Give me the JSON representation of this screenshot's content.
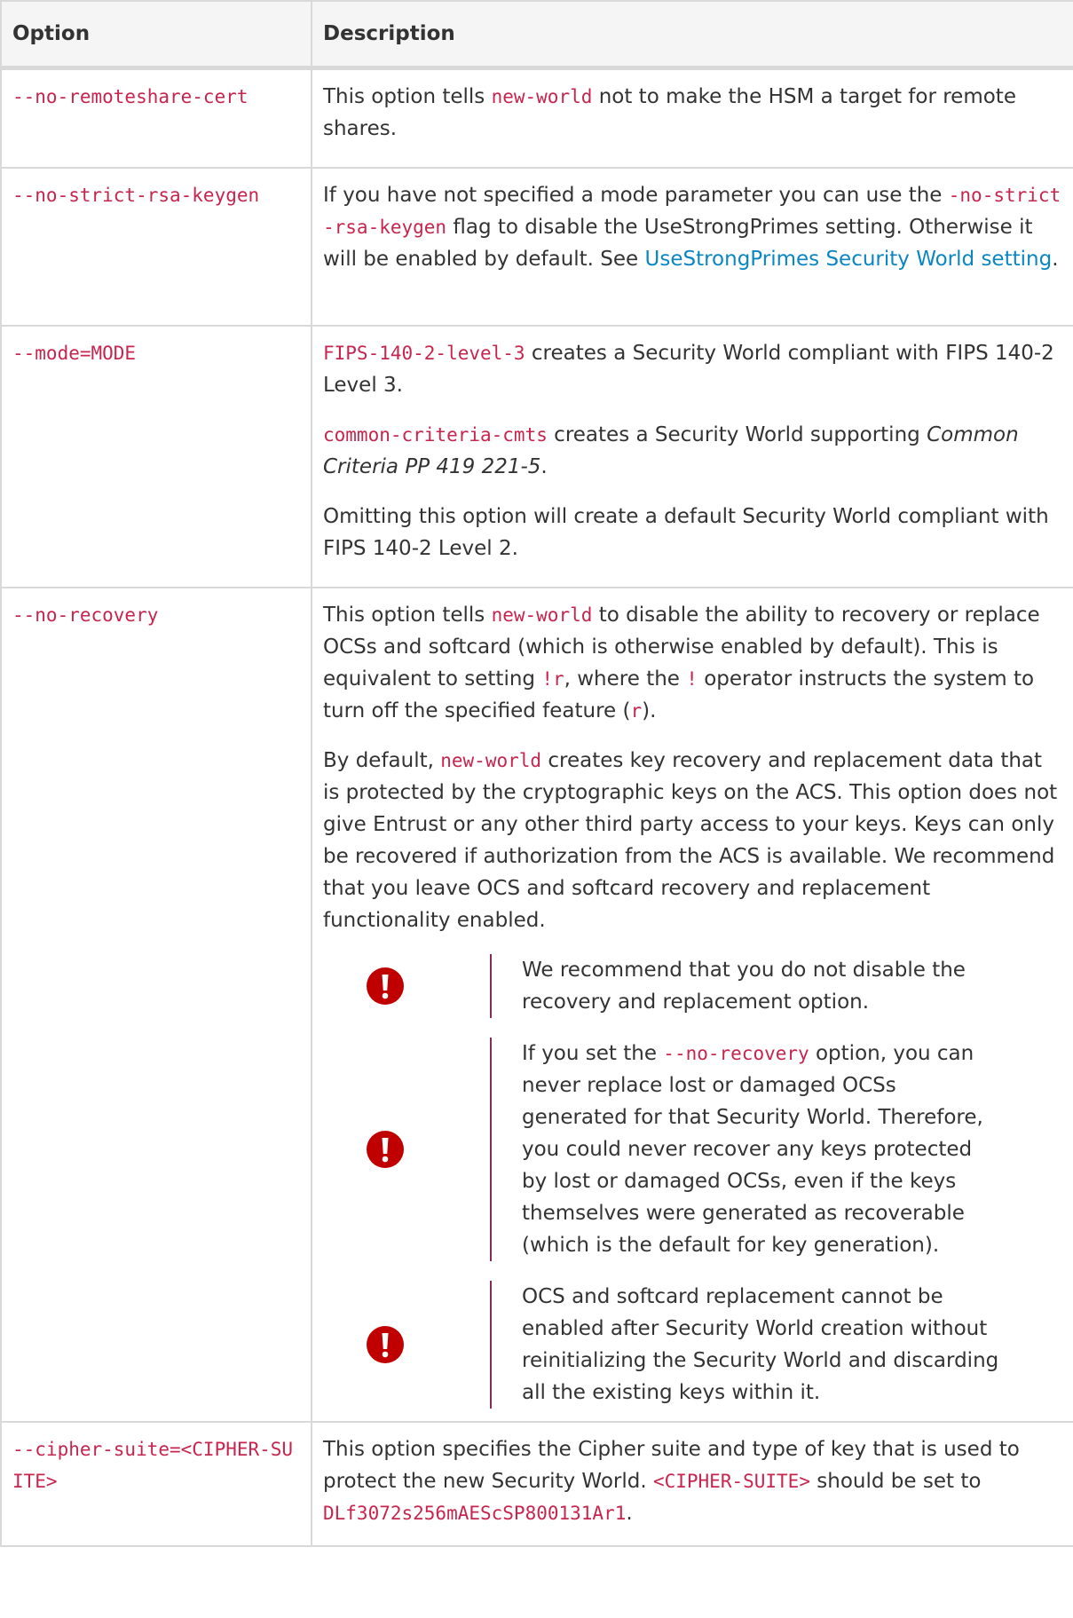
{
  "table": {
    "headers": {
      "option": "Option",
      "description": "Description"
    },
    "rows": {
      "remoteshare": {
        "option": "--no-remoteshare-cert",
        "d1": "This option tells ",
        "d1_code": "new-world",
        "d1_rest": " not to make the HSM a target for remote shares."
      },
      "strict_rsa": {
        "option": "--no-strict-rsa-keygen",
        "d1": "If you have not specified a mode parameter you can use the ",
        "d1_code": "-no-strict -rsa-keygen",
        "d1_rest": " flag to disable the UseStrongPrimes setting. Otherwise it will be enabled by default. See ",
        "d1_link": "UseStrongPrimes Security World setting",
        "d1_end": "."
      },
      "mode": {
        "option": "--mode=MODE",
        "p1_code": "FIPS-140-2-level-3",
        "p1_rest": " creates a Security World compliant with FIPS 140-2 Level 3.",
        "p2_code": "common-criteria-cmts",
        "p2_rest": " creates a Security World supporting ",
        "p2_em": "Common Criteria PP 419 221-5",
        "p2_end": ".",
        "p3": "Omitting this option will create a default Security World compliant with FIPS 140-2 Level 2."
      },
      "recovery": {
        "option": "--no-recovery",
        "p1_a": "This option tells ",
        "p1_code1": "new-world",
        "p1_b": " to disable the ability to recovery or replace OCSs and softcard (which is otherwise enabled by default). This is equivalent to setting ",
        "p1_code2": "!r",
        "p1_c": ", where the ",
        "p1_code3": "!",
        "p1_d": " operator instructs the system to turn off the specified feature (",
        "p1_code4": "r",
        "p1_e": ").",
        "p2_a": "By default, ",
        "p2_code": "new-world",
        "p2_b": " creates key recovery and replacement data that is protected by the cryptographic keys on the ACS. This option does not give Entrust or any other third party access to your keys. Keys can only be recovered if authorization from the ACS is available. We recommend that you leave OCS and softcard recovery and replacement functionality enabled.",
        "note1": "We recommend that you do not disable the recovery and replacement option.",
        "note2_a": "If you set the ",
        "note2_code": "--no-recovery",
        "note2_b": " option, you can never replace lost or damaged OCSs generated for that Security World. Therefore, you could never recover any keys protected by lost or damaged OCSs, even if the keys themselves were generated as recoverable (which is the default for key generation).",
        "note3": "OCS and softcard replacement cannot be enabled after Security World creation without reinitializing the Security World and discarding all the existing keys within it."
      },
      "cipher": {
        "option": "--cipher-suite=<CIPHER-SUITE>",
        "d1": "This option specifies the Cipher suite and type of key that is used to protect the new Security World. ",
        "d1_code": "<CIPHER-SUITE>",
        "d1_rest": " should be set to ",
        "d1_code2": "DLf3072s256mAEScSP800131Ar1",
        "d1_end": "."
      }
    }
  },
  "colors": {
    "code": "#c7254e",
    "link": "#0a86c2",
    "warning_icon": "#c00000",
    "note_bar": "#8a2a5a",
    "header_bg": "#f5f5f5",
    "border": "#d9d9d9"
  },
  "icons": {
    "warning": "exclamation-circle-icon"
  }
}
